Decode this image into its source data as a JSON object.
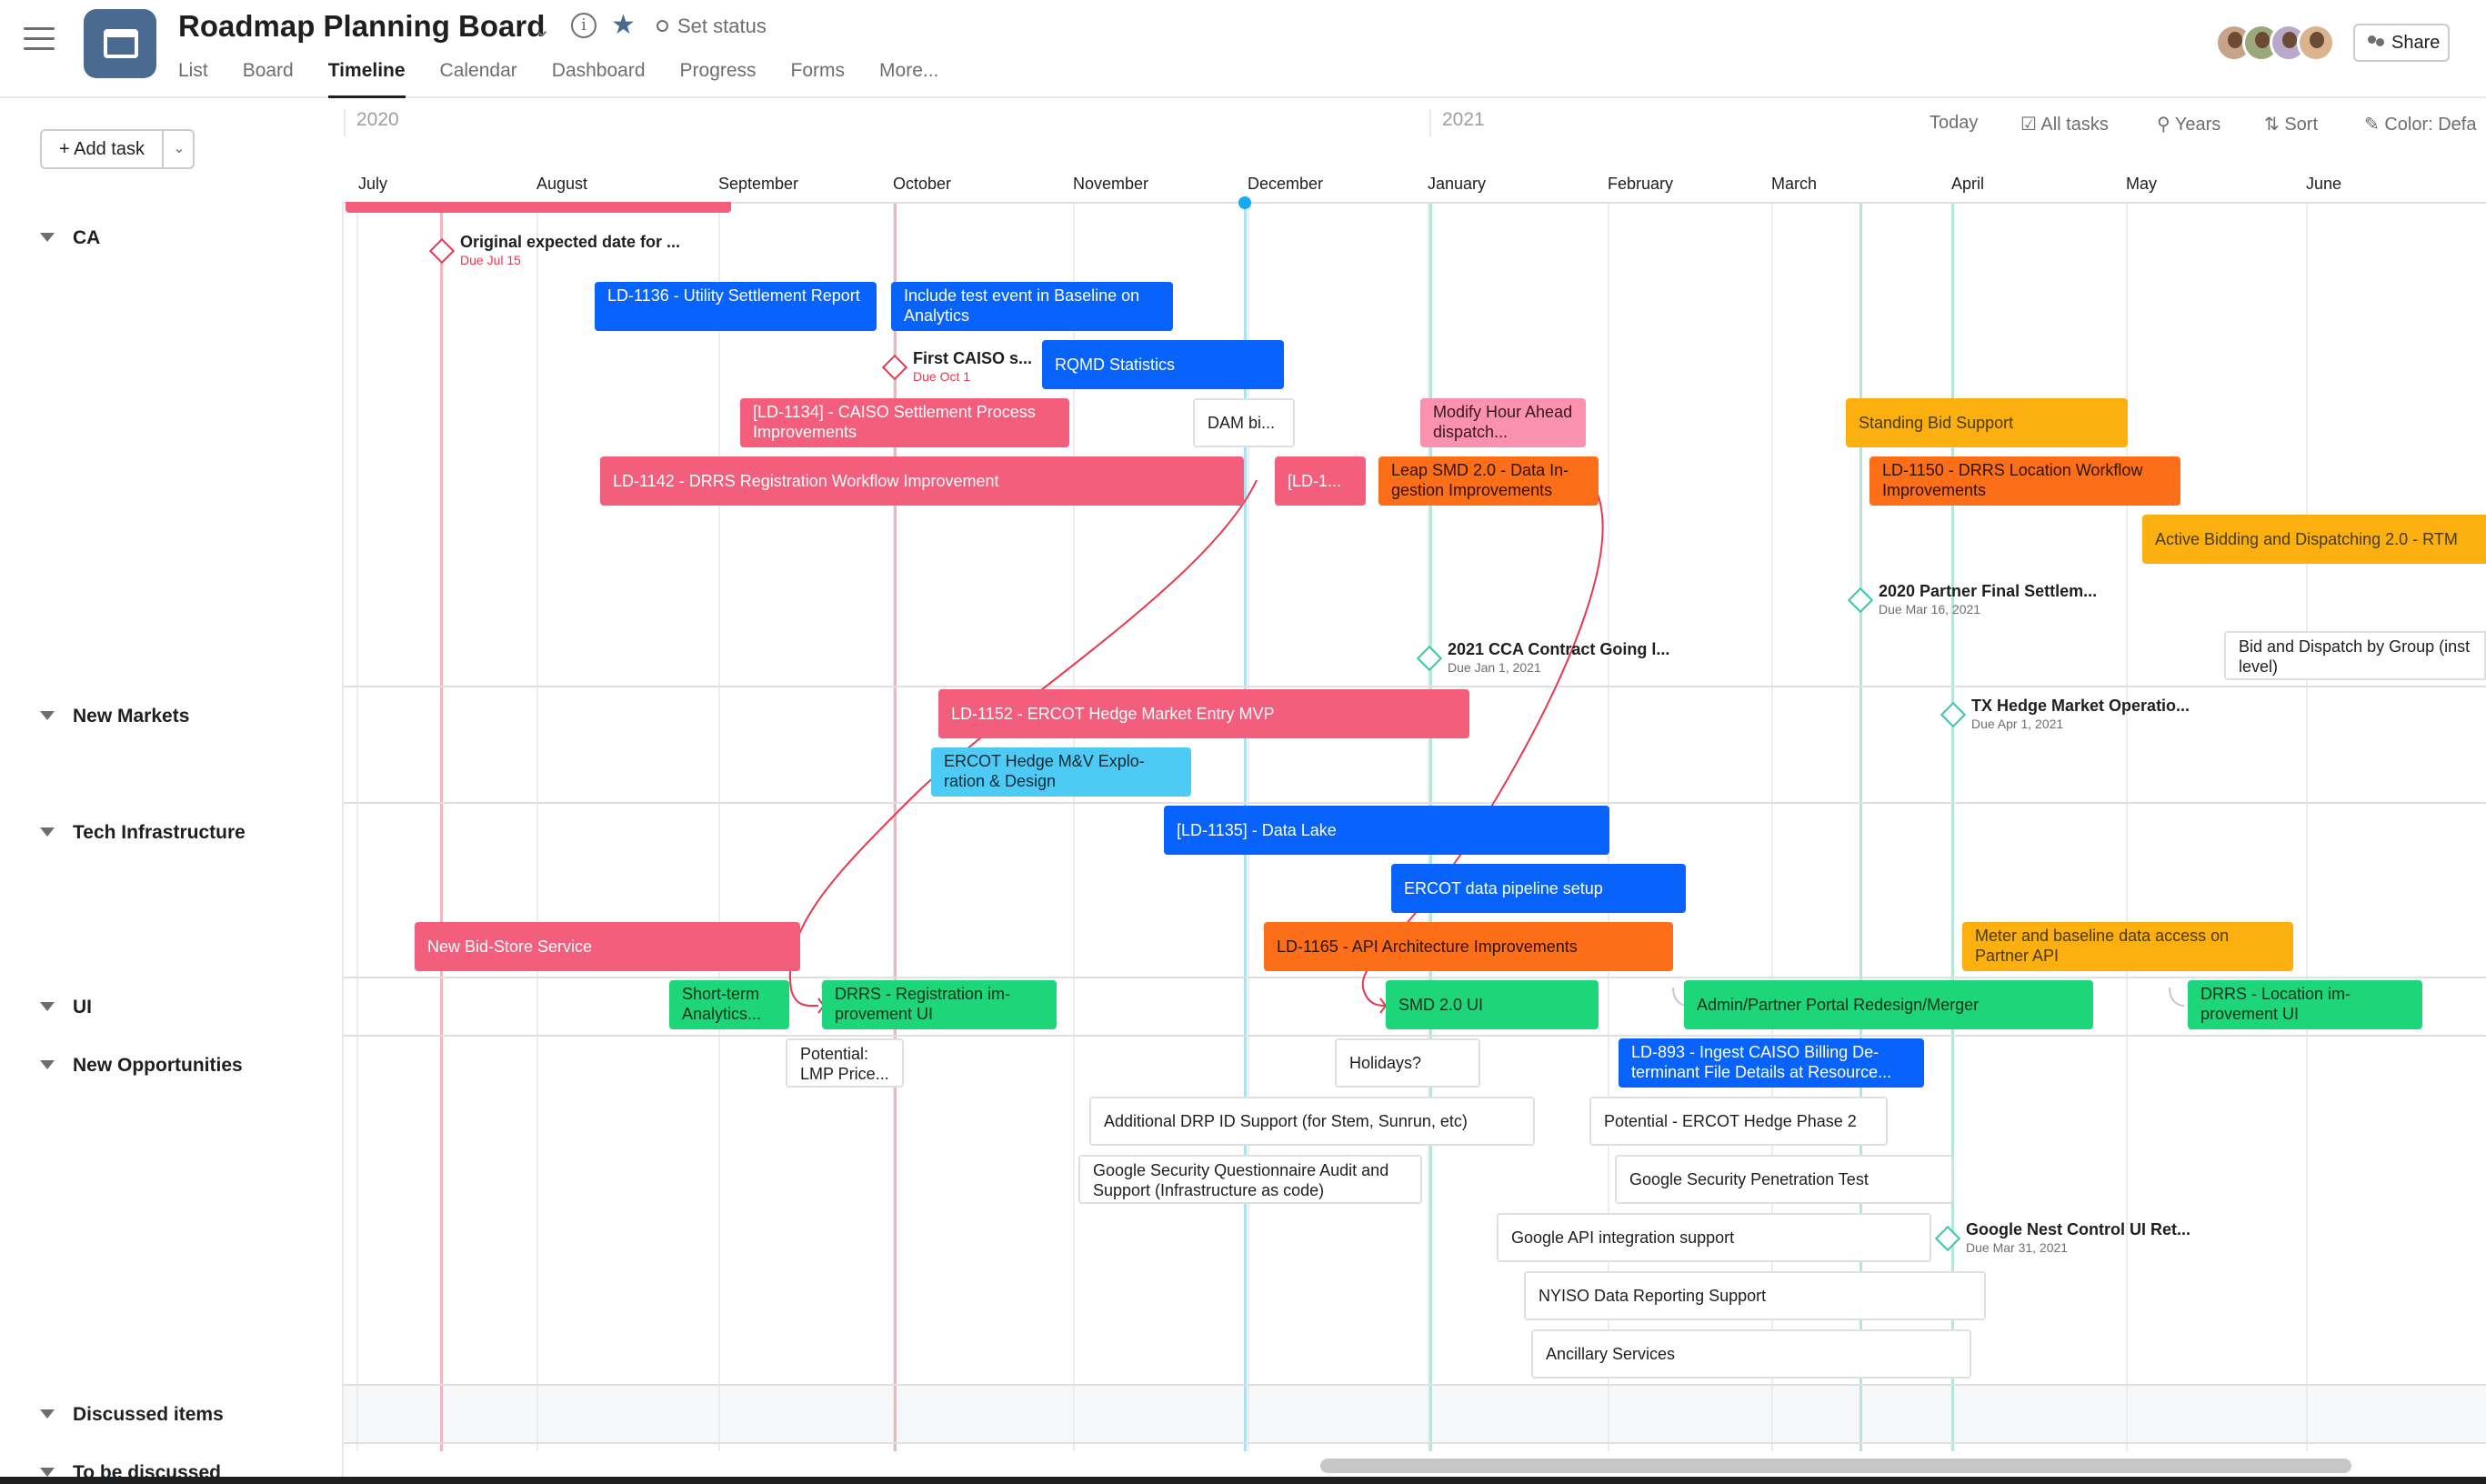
{
  "header": {
    "title": "Roadmap Planning Board",
    "status": "Set status",
    "tabs": [
      "List",
      "Board",
      "Timeline",
      "Calendar",
      "Dashboard",
      "Progress",
      "Forms",
      "More..."
    ],
    "active_tab": "Timeline",
    "share_label": "Share"
  },
  "toolbar": {
    "add_task_label": "+ Add task",
    "years": [
      "2020",
      "2021"
    ],
    "actions": [
      "Today",
      "All tasks",
      "Years",
      "Sort",
      "Color: Defa"
    ]
  },
  "months": [
    "July",
    "August",
    "September",
    "October",
    "November",
    "December",
    "January",
    "February",
    "March",
    "April",
    "May",
    "June"
  ],
  "sections": [
    "CA",
    "New Markets",
    "Tech Infrastructure",
    "UI",
    "New Opportunities",
    "Discussed items",
    "To be discussed"
  ],
  "colors": {
    "pink": "#f35e7d",
    "light_pink": "#fa91ae",
    "blue": "#0763fb",
    "cyan": "#4ecbf5",
    "orange": "#fd6e19",
    "yellow": "#fbb00f",
    "green": "#1ed67a",
    "milestone_red": "#e8384f",
    "milestone_teal": "#37c5ab"
  },
  "tasks": {
    "t1": "Original expected date for ...",
    "t1_due": "Due Jul 15",
    "t2": "LD-1136 - Utility Settlement Report",
    "t3": "Include test event in Baseline on Analytics",
    "t4": "First CAISO s...",
    "t4_due": "Due Oct 1",
    "t5": "RQMD Statistics",
    "t6": "[LD-1134] - CAISO Settlement Process Improvements",
    "t7": "DAM bi...",
    "t8": "Modify Hour Ahead dispatch...",
    "t9": "Standing Bid Support",
    "t10": "LD-1142 - DRRS Registration Workflow Improvement",
    "t11": "[LD-1...",
    "t12": "Leap SMD 2.0 - Data In-gestion Improvements",
    "t13": "LD-1150 - DRRS Location Workflow Improvements",
    "t14": "Active Bidding and Dispatching 2.0 - RTM",
    "t15": "2020 Partner Final Settlem...",
    "t15_due": "Due Mar 16, 2021",
    "t16": "2021 CCA Contract Going l...",
    "t16_due": "Due Jan 1, 2021",
    "t17": "Bid and Dispatch by Group (inst level)",
    "t18": "LD-1152 - ERCOT Hedge Market Entry MVP",
    "t19": "TX Hedge Market Operatio...",
    "t19_due": "Due Apr 1, 2021",
    "t20": "ERCOT Hedge M&V Explo-ration & Design",
    "t21": "[LD-1135] - Data Lake",
    "t22": "ERCOT data pipeline setup",
    "t23": "New Bid-Store Service",
    "t24": "LD-1165 - API Architecture Improvements",
    "t25": "Meter and baseline data access on Partner API",
    "t26": "Short-term Analytics...",
    "t27": "DRRS - Registration im-provement UI",
    "t28": "SMD 2.0 UI",
    "t29": "Admin/Partner Portal Redesign/Merger",
    "t30": "DRRS - Location im-provement UI",
    "t31": "Potential: LMP Price...",
    "t32": "Holidays?",
    "t33": "LD-893 - Ingest CAISO Billing De-terminant File Details at Resource...",
    "t34": "Additional DRP ID Support (for Stem, Sunrun, etc)",
    "t35": "Potential - ERCOT Hedge Phase 2",
    "t36": "Google Security Questionnaire Audit and Support (Infrastructure as code)",
    "t37": "Google Security Penetration Test",
    "t38": "Google API integration support",
    "t39": "Google Nest Control UI Ret...",
    "t39_due": "Due Mar 31, 2021",
    "t40": "NYISO Data Reporting Support",
    "t41": "Ancillary Services"
  }
}
